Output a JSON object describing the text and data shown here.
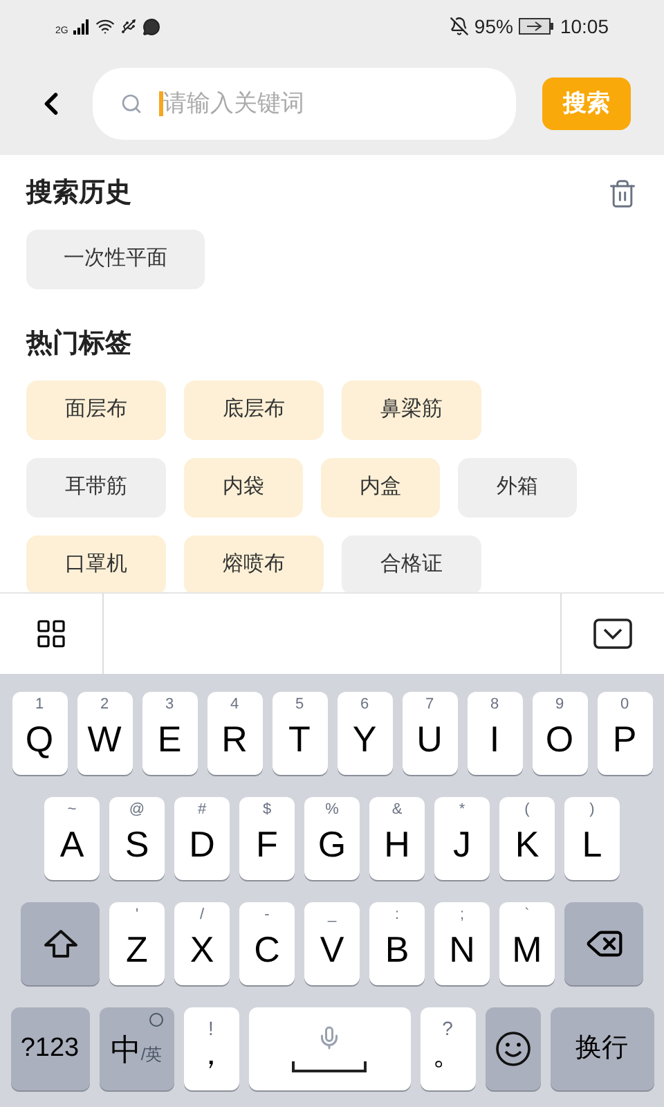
{
  "status_bar": {
    "network": "2G",
    "battery": "95%",
    "time": "10:05"
  },
  "search": {
    "placeholder": "请输入关键词",
    "button": "搜索"
  },
  "history": {
    "title": "搜索历史",
    "items": [
      "一次性平面"
    ]
  },
  "hot_tags": {
    "title": "热门标签",
    "rows": [
      [
        {
          "label": "面层布",
          "color": "#fdf0d6"
        },
        {
          "label": "底层布",
          "color": "#fdf0d6"
        },
        {
          "label": "鼻梁筋",
          "color": "#fdf0d6"
        }
      ],
      [
        {
          "label": "耳带筋",
          "color": "#efefef"
        },
        {
          "label": "内袋",
          "color": "#fdf0d6"
        },
        {
          "label": "内盒",
          "color": "#fdf0d6"
        },
        {
          "label": "外箱",
          "color": "#efefef"
        }
      ],
      [
        {
          "label": "口罩机",
          "color": "#fdf0d6"
        },
        {
          "label": "熔喷布",
          "color": "#fdf0d6"
        },
        {
          "label": "合格证",
          "color": "#efefef"
        }
      ]
    ]
  },
  "keyboard": {
    "rows": [
      {
        "keys": [
          {
            "kind": "letter",
            "label": "Q",
            "hint": "1"
          },
          {
            "kind": "letter",
            "label": "W",
            "hint": "2"
          },
          {
            "kind": "letter",
            "label": "E",
            "hint": "3"
          },
          {
            "kind": "letter",
            "label": "R",
            "hint": "4"
          },
          {
            "kind": "letter",
            "label": "T",
            "hint": "5"
          },
          {
            "kind": "letter",
            "label": "Y",
            "hint": "6"
          },
          {
            "kind": "letter",
            "label": "U",
            "hint": "7"
          },
          {
            "kind": "letter",
            "label": "I",
            "hint": "8"
          },
          {
            "kind": "letter",
            "label": "O",
            "hint": "9"
          },
          {
            "kind": "letter",
            "label": "P",
            "hint": "0"
          }
        ]
      },
      {
        "keys": [
          {
            "kind": "letter",
            "label": "A",
            "hint": "~"
          },
          {
            "kind": "letter",
            "label": "S",
            "hint": "@"
          },
          {
            "kind": "letter",
            "label": "D",
            "hint": "#"
          },
          {
            "kind": "letter",
            "label": "F",
            "hint": "$"
          },
          {
            "kind": "letter",
            "label": "G",
            "hint": "%"
          },
          {
            "kind": "letter",
            "label": "H",
            "hint": "&"
          },
          {
            "kind": "letter",
            "label": "J",
            "hint": "*"
          },
          {
            "kind": "letter",
            "label": "K",
            "hint": "("
          },
          {
            "kind": "letter",
            "label": "L",
            "hint": ")"
          }
        ]
      },
      {
        "keys": [
          {
            "kind": "shift"
          },
          {
            "kind": "letter",
            "label": "Z",
            "hint": "'"
          },
          {
            "kind": "letter",
            "label": "X",
            "hint": "/"
          },
          {
            "kind": "letter",
            "label": "C",
            "hint": "-"
          },
          {
            "kind": "letter",
            "label": "V",
            "hint": "_"
          },
          {
            "kind": "letter",
            "label": "B",
            "hint": ":"
          },
          {
            "kind": "letter",
            "label": "N",
            "hint": ";"
          },
          {
            "kind": "letter",
            "label": "M",
            "hint": "`"
          },
          {
            "kind": "backspace"
          }
        ]
      },
      {
        "keys": [
          {
            "kind": "function",
            "label": "?123"
          },
          {
            "kind": "lang",
            "label": "中",
            "sub": "/英"
          },
          {
            "kind": "punct",
            "label": "，",
            "hint": "!"
          },
          {
            "kind": "space"
          },
          {
            "kind": "punct",
            "label": "。",
            "hint": "?"
          },
          {
            "kind": "emoji"
          },
          {
            "kind": "function",
            "label": "换行"
          }
        ]
      }
    ]
  }
}
